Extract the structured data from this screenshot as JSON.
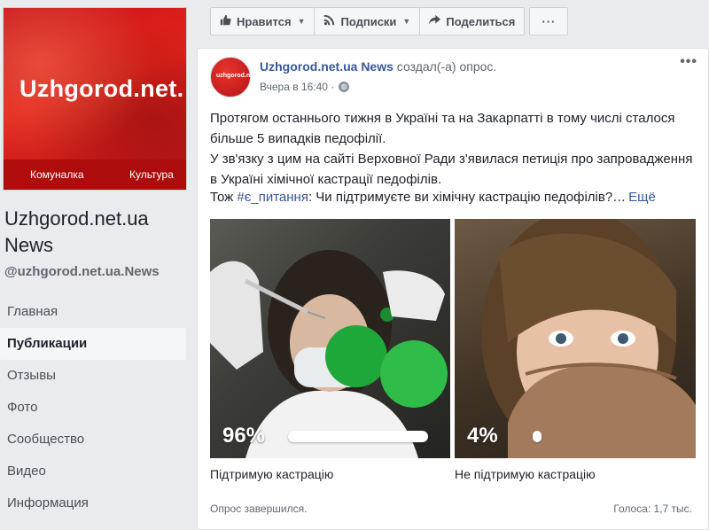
{
  "page": {
    "cover_brand": "Uzhgorod.net.",
    "cover_nav": [
      "Комуналка",
      "Культура"
    ],
    "name": "Uzhgorod.net.ua News",
    "handle": "@uzhgorod.net.ua.News"
  },
  "nav": {
    "items": [
      {
        "label": "Главная",
        "active": false
      },
      {
        "label": "Публикации",
        "active": true
      },
      {
        "label": "Отзывы",
        "active": false
      },
      {
        "label": "Фото",
        "active": false
      },
      {
        "label": "Сообщество",
        "active": false
      },
      {
        "label": "Видео",
        "active": false
      },
      {
        "label": "Информация",
        "active": false
      }
    ]
  },
  "actions": {
    "like": "Нравится",
    "follow": "Подписки",
    "share": "Поделиться",
    "more": "···"
  },
  "post": {
    "avatar_text": "uzhgorod.net",
    "author": "Uzhgorod.net.ua News",
    "action": " создал(-а) опрос.",
    "time": "Вчера в 16:40 ·",
    "body_line1": "Протягом останнього тижня в Україні та на Закарпатті в тому числі сталося більше 5 випадків педофілії.",
    "body_line2": "У зв'язку з цим на сайті Верховної Ради з'явилася петиція про запровадження в Україні хімічної кастрації педофілів.",
    "question_prefix": "Тож ",
    "question_tag": "#є_питання",
    "question_text": ": Чи підтримуєте ви хімічну кастрацію педофілів?…",
    "more_link": "Ещё",
    "menu": "•••"
  },
  "poll": {
    "options": [
      {
        "label": "Підтримую кастрацію",
        "percent_text": "96%",
        "percent": 96
      },
      {
        "label": "Не підтримую кастрацію",
        "percent_text": "4%",
        "percent": 4
      }
    ],
    "status": "Опрос завершился.",
    "votes": "Голоса: 1,7 тыс."
  },
  "colors": {
    "link": "#385898",
    "brand_red": "#e2231a",
    "background": "#e9ebee"
  }
}
